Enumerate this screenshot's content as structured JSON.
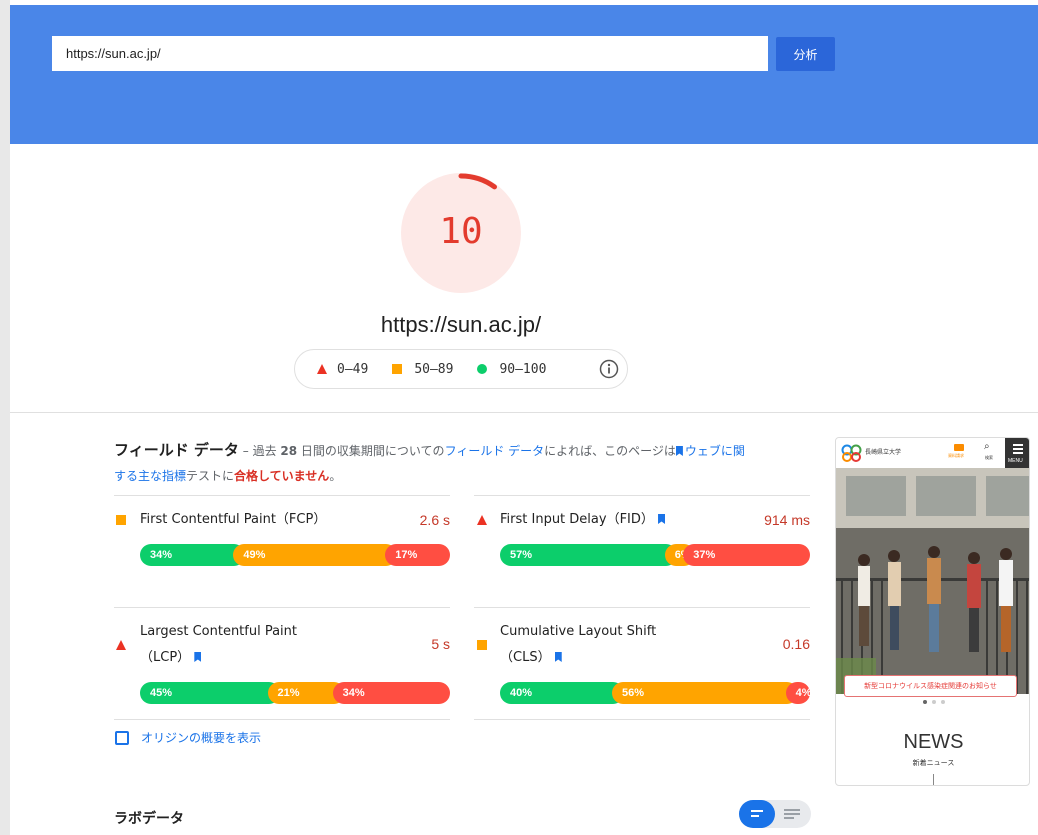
{
  "header": {
    "url_value": "https://sun.ac.jp/",
    "analyze_label": "分析"
  },
  "score": {
    "value": "10",
    "fraction": 0.1,
    "color": "#e33b2e",
    "tested_url": "https://sun.ac.jp/"
  },
  "legend": {
    "fail": "0–49",
    "average": "50–89",
    "pass": "90–100",
    "fail_color": "#eb3223",
    "average_color": "#ffa400",
    "pass_color": "#0cce6b"
  },
  "field_data": {
    "title": "フィールド データ",
    "desc_1": " – 過去 ",
    "days": "28",
    "desc_2": " 日間の収集期間についての",
    "field_link": "フィールド データ",
    "desc_3": "によれば、このページは",
    "cwv_link": "ウェブに関する主な指標",
    "desc_4": "テストに",
    "result": "合格していません",
    "desc_5": "。",
    "metrics": [
      {
        "name": "First Contentful Paint（FCP）",
        "value": "2.6 s",
        "status": "average",
        "dist": {
          "good": "34%",
          "avg": "49%",
          "poor": "17%"
        }
      },
      {
        "name": "First Input Delay（FID）",
        "value": "914 ms",
        "status": "fail",
        "dist": {
          "good": "57%",
          "avg": "6%",
          "poor": "37%"
        }
      },
      {
        "name": "Largest Contentful Paint",
        "name2": "（LCP）",
        "value": "5 s",
        "status": "fail",
        "dist": {
          "good": "45%",
          "avg": "21%",
          "poor": "34%"
        }
      },
      {
        "name": "Cumulative Layout Shift",
        "name2": "（CLS）",
        "value": "0.16",
        "status": "average",
        "dist": {
          "good": "40%",
          "avg": "56%",
          "poor": "4%"
        }
      }
    ],
    "origin_label": "オリジンの概要を表示"
  },
  "lab_data": {
    "title": "ラボデータ"
  },
  "thumbnail": {
    "logo_text": "長崎県立大学",
    "menu_label": "MENU",
    "search_label": "検索",
    "request_label": "資料請求",
    "banner": "新型コロナウイルス感染症関連のお知らせ",
    "news": "NEWS",
    "news_sub": "新着ニュース"
  }
}
